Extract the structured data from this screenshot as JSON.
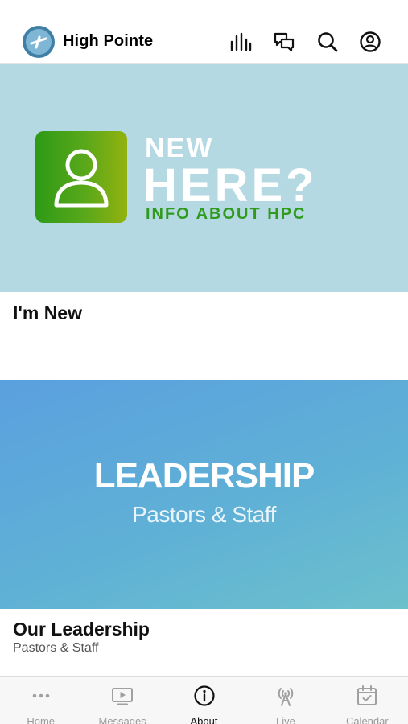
{
  "header": {
    "brand": "High Pointe",
    "icons": [
      "bars-icon",
      "chat-icon",
      "search-icon",
      "profile-icon"
    ]
  },
  "cards": [
    {
      "image": {
        "line1": "NEW",
        "line2": "HERE?",
        "line3": "INFO ABOUT HPC",
        "icon": "person-icon"
      },
      "title": "I'm New"
    },
    {
      "image": {
        "title": "LEADERSHIP",
        "subtitle": "Pastors & Staff"
      },
      "title": "Our Leadership",
      "subtitle": "Pastors & Staff"
    }
  ],
  "tabs": [
    {
      "label": "Home",
      "icon": "more-dots-icon",
      "active": false
    },
    {
      "label": "Messages",
      "icon": "video-play-icon",
      "active": false
    },
    {
      "label": "About",
      "icon": "info-icon",
      "active": true
    },
    {
      "label": "Live",
      "icon": "broadcast-icon",
      "active": false
    },
    {
      "label": "Calendar",
      "icon": "calendar-icon",
      "active": false
    }
  ],
  "colors": {
    "newhere_bg": "#b5d9e3",
    "green_accent": "#2f9a1c",
    "leadership_bg": "#5aa0df",
    "active_tab": "#111111",
    "inactive_tab": "#9a9a9a"
  }
}
